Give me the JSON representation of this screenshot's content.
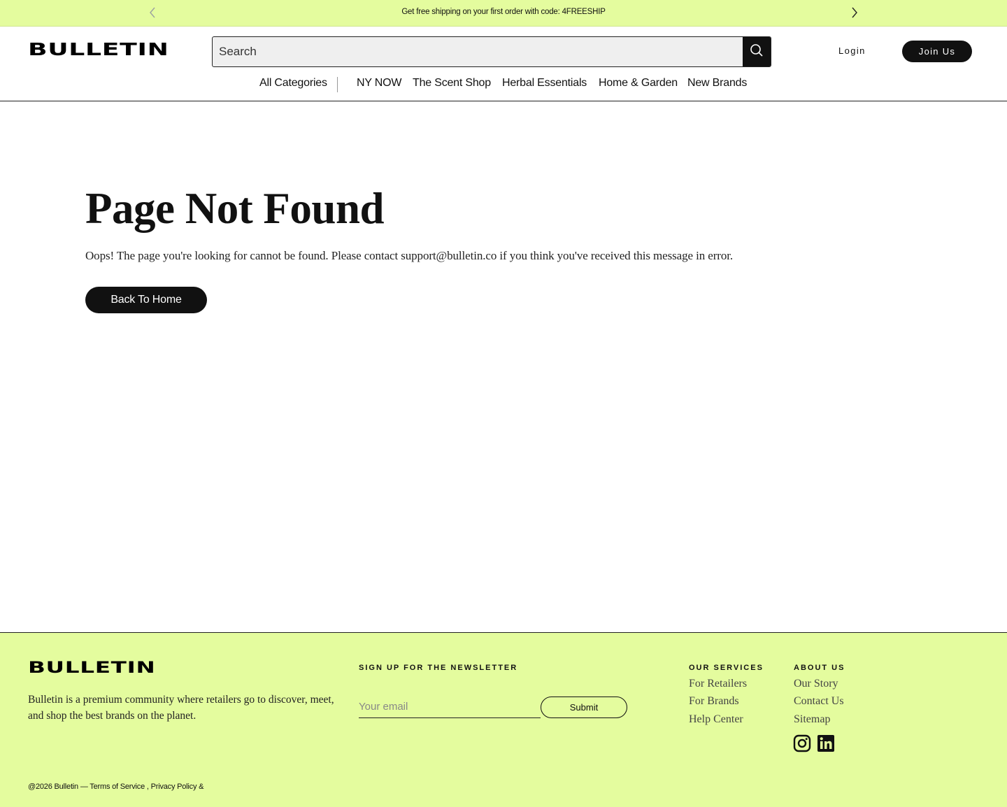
{
  "announcement": {
    "message": "Get free shipping on your first order with code: 4FREESHIP",
    "prev_icon": "chevron-left-icon",
    "next_icon": "chevron-right-icon"
  },
  "header": {
    "logo": "BULLETIN",
    "search_placeholder": "Search",
    "search_icon": "search-icon",
    "login_label": "Login",
    "join_label": "Join Us"
  },
  "nav": {
    "items": [
      {
        "label": "All Categories"
      },
      {
        "label": "NY NOW"
      },
      {
        "label": "The Scent Shop"
      },
      {
        "label": "Herbal Essentials"
      },
      {
        "label": "Home & Garden"
      },
      {
        "label": "New Brands"
      }
    ]
  },
  "main": {
    "title": "Page Not Found",
    "message": "Oops! The page you're looking for cannot be found. Please contact support@bulletin.co if you think you've received this message in error.",
    "back_button": "Back To Home"
  },
  "footer": {
    "logo": "BULLETIN",
    "description": "Bulletin is a premium community where retailers go to discover, meet, and shop the best brands on the planet.",
    "newsletter": {
      "heading": "SIGN UP FOR THE NEWSLETTER",
      "email_placeholder": "Your email",
      "submit_label": "Submit"
    },
    "services": {
      "heading": "OUR SERVICES",
      "links": [
        {
          "label": "For Retailers"
        },
        {
          "label": "For Brands"
        },
        {
          "label": "Help Center"
        }
      ]
    },
    "about": {
      "heading": "ABOUT US",
      "links": [
        {
          "label": "Our Story"
        },
        {
          "label": "Contact Us"
        },
        {
          "label": "Sitemap"
        }
      ]
    },
    "social": [
      "instagram-icon",
      "linkedin-icon"
    ],
    "copyright": {
      "prefix": "@2026 Bulletin — ",
      "terms": "Terms of Service",
      "separator": " , ",
      "privacy": "Privacy Policy &"
    }
  },
  "colors": {
    "accent_lime": "#e4fc9e",
    "primary_dark": "#111111",
    "background": "#ffffff"
  }
}
